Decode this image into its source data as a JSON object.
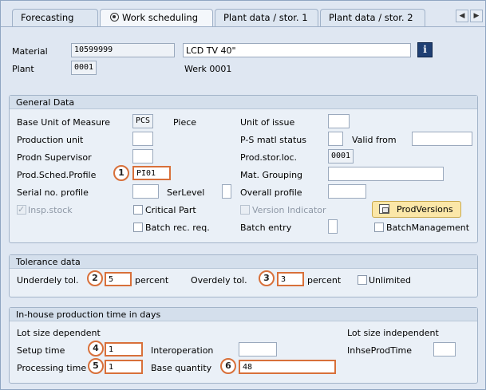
{
  "tabs": {
    "forecasting": "Forecasting",
    "work_scheduling": "Work scheduling",
    "plant_data_1": "Plant data / stor. 1",
    "plant_data_2": "Plant data / stor. 2"
  },
  "header": {
    "material_label": "Material",
    "material_value": "10599999",
    "material_desc": "LCD TV 40\"",
    "plant_label": "Plant",
    "plant_value": "0001",
    "plant_desc": "Werk 0001"
  },
  "general": {
    "title": "General Data",
    "base_uom_label": "Base Unit of Measure",
    "base_uom_value": "PCS",
    "base_uom_desc": "Piece",
    "unit_issue_label": "Unit of issue",
    "prod_unit_label": "Production unit",
    "ps_status_label": "P-S matl status",
    "valid_from_label": "Valid from",
    "prodn_supervisor_label": "Prodn Supervisor",
    "prod_stor_loc_label": "Prod.stor.loc.",
    "prod_stor_loc_value": "0001",
    "prod_sched_profile_label": "Prod.Sched.Profile",
    "prod_sched_profile_value": "PI01",
    "mat_grouping_label": "Mat. Grouping",
    "serial_no_label": "Serial no. profile",
    "ser_level_label": "SerLevel",
    "overall_profile_label": "Overall profile",
    "insp_stock_label": "Insp.stock",
    "critical_part_label": "Critical Part",
    "version_indicator_label": "Version Indicator",
    "prod_versions_label": "ProdVersions",
    "batch_rec_label": "Batch rec. req.",
    "batch_entry_label": "Batch entry",
    "batch_mgmt_label": "BatchManagement"
  },
  "tolerance": {
    "title": "Tolerance data",
    "underdely_label": "Underdely tol.",
    "underdely_value": "5",
    "percent1": "percent",
    "overdely_label": "Overdely tol.",
    "overdely_value": "3",
    "percent2": "percent",
    "unlimited_label": "Unlimited"
  },
  "inhouse": {
    "title": "In-house production time in days",
    "lot_dep_label": "Lot size dependent",
    "lot_indep_label": "Lot size independent",
    "setup_label": "Setup time",
    "setup_value": "1",
    "interop_label": "Interoperation",
    "inhse_label": "InhseProdTime",
    "processing_label": "Processing time",
    "processing_value": "1",
    "base_qty_label": "Base quantity",
    "base_qty_value": "48"
  },
  "badges": [
    "1",
    "2",
    "3",
    "4",
    "5",
    "6"
  ],
  "nav": {
    "prev": "◀",
    "next": "▶"
  }
}
